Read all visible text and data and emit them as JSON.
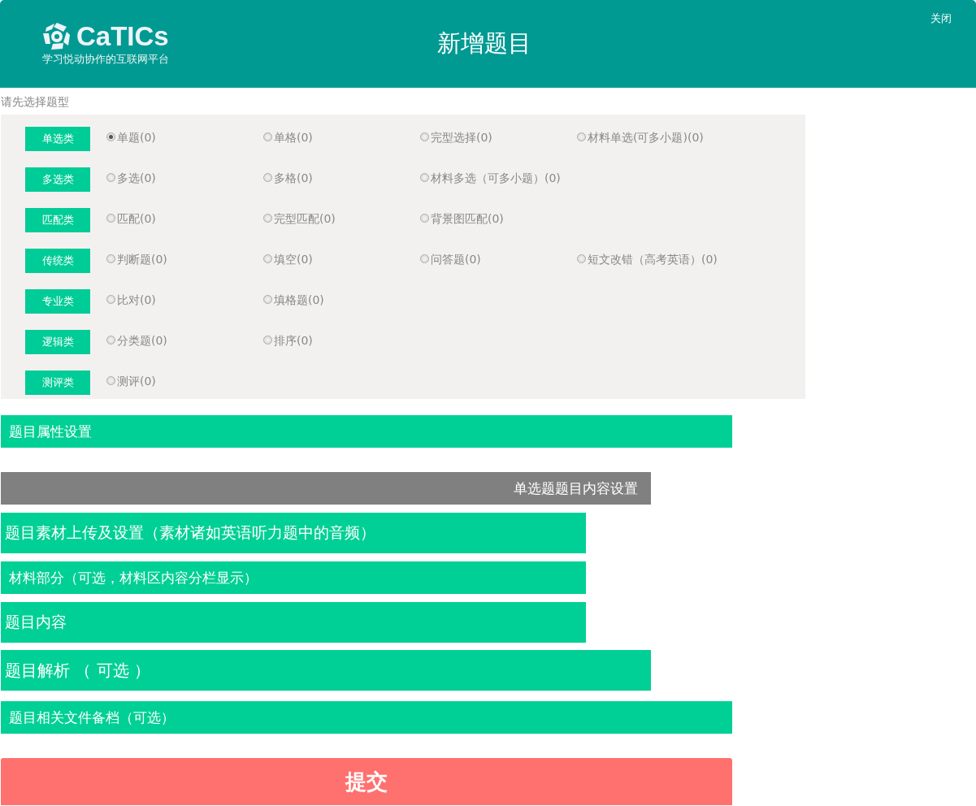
{
  "header": {
    "brand": "CaTICs",
    "slogan": "学习悦动协作的互联网平台",
    "title": "新增题目",
    "close": "关闭"
  },
  "prompt": "请先选择题型",
  "categories": [
    {
      "label": "单选类",
      "options": [
        {
          "label": "单题(0)",
          "selected": true
        },
        {
          "label": "单格(0)",
          "selected": false
        },
        {
          "label": "完型选择(0)",
          "selected": false
        },
        {
          "label": "材料单选(可多小题)(0)",
          "selected": false
        }
      ]
    },
    {
      "label": "多选类",
      "options": [
        {
          "label": "多选(0)",
          "selected": false
        },
        {
          "label": "多格(0)",
          "selected": false
        },
        {
          "label": "材料多选（可多小题）(0)",
          "selected": false
        }
      ]
    },
    {
      "label": "匹配类",
      "options": [
        {
          "label": "匹配(0)",
          "selected": false
        },
        {
          "label": "完型匹配(0)",
          "selected": false
        },
        {
          "label": "背景图匹配(0)",
          "selected": false
        }
      ]
    },
    {
      "label": "传统类",
      "options": [
        {
          "label": "判断题(0)",
          "selected": false
        },
        {
          "label": "填空(0)",
          "selected": false
        },
        {
          "label": "问答题(0)",
          "selected": false
        },
        {
          "label": "短文改错（高考英语）(0)",
          "selected": false
        }
      ]
    },
    {
      "label": "专业类",
      "options": [
        {
          "label": "比对(0)",
          "selected": false
        },
        {
          "label": "填格题(0)",
          "selected": false
        }
      ]
    },
    {
      "label": "逻辑类",
      "options": [
        {
          "label": "分类题(0)",
          "selected": false
        },
        {
          "label": "排序(0)",
          "selected": false
        }
      ]
    },
    {
      "label": "测评类",
      "options": [
        {
          "label": "测评(0)",
          "selected": false
        }
      ]
    }
  ],
  "sections": [
    {
      "label": "题目属性设置",
      "kind": "panel"
    },
    {
      "label": "单选题题目内容设置",
      "kind": "caption"
    },
    {
      "label": "题目素材上传及设置（素材诸如英语听力题中的音频）",
      "kind": "panel"
    },
    {
      "label": "材料部分（可选，材料区内容分栏显示）",
      "kind": "panel"
    },
    {
      "label": "题目内容",
      "kind": "panel"
    },
    {
      "label": "题目解析 （ 可选 ）",
      "kind": "panel"
    },
    {
      "label": "题目相关文件备档（可选）",
      "kind": "panel"
    }
  ],
  "submit": "提交"
}
